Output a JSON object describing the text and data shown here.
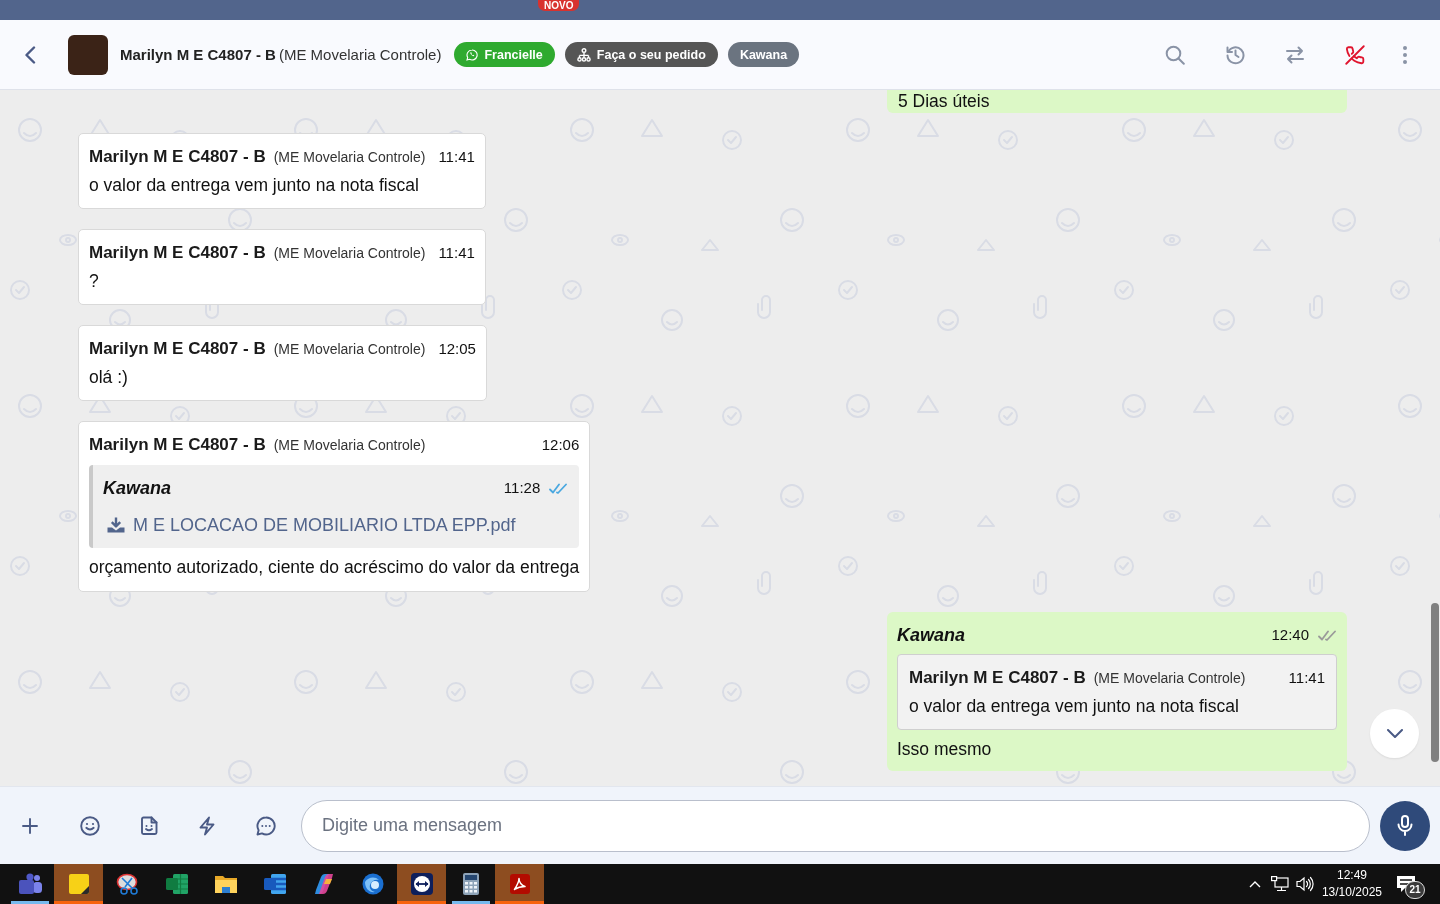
{
  "top_strip": {
    "badge": "NOVO"
  },
  "header": {
    "title": "Marilyn M E C4807 - B",
    "subtitle": "(ME Movelaria Controle)",
    "tags": [
      {
        "kind": "chat",
        "label": "Francielle",
        "color": "#2faa2f"
      },
      {
        "kind": "tree",
        "label": "Faça o seu pedido",
        "color": "#555555"
      },
      {
        "kind": "plain",
        "label": "Kawana",
        "color": "#6b7480"
      }
    ]
  },
  "messages": [
    {
      "kind": "outgoing",
      "text": "5 Dias úteis"
    },
    {
      "kind": "incoming",
      "sender": "Marilyn M E C4807 - B",
      "org": "(ME Movelaria Controle)",
      "time": "11:41",
      "text": "o valor da entrega vem junto na nota fiscal"
    },
    {
      "kind": "incoming",
      "sender": "Marilyn M E C4807 - B",
      "org": "(ME Movelaria Controle)",
      "time": "11:41",
      "text": "?"
    },
    {
      "kind": "incoming",
      "sender": "Marilyn M E C4807 - B",
      "org": "(ME Movelaria Controle)",
      "time": "12:05",
      "text": "olá :)"
    },
    {
      "kind": "incoming",
      "sender": "Marilyn M E C4807 - B",
      "org": "(ME Movelaria Controle)",
      "time": "12:06",
      "quote": {
        "kind": "outgoing",
        "sender": "Kawana",
        "time": "11:28",
        "read": true,
        "attachment": "M E LOCACAO DE MOBILIARIO LTDA EPP.pdf"
      },
      "text": "orçamento autorizado, ciente do acréscimo do valor da entrega"
    },
    {
      "kind": "outgoing",
      "sender": "Kawana",
      "time": "12:40",
      "read": false,
      "quote": {
        "kind": "incoming",
        "sender": "Marilyn M E C4807 - B",
        "org": "(ME Movelaria Controle)",
        "time": "11:41",
        "text": "o valor da entrega vem junto na nota fiscal"
      },
      "text": "Isso mesmo"
    }
  ],
  "composer": {
    "placeholder": "Digite uma mensagem"
  },
  "taskbar": {
    "apps": [
      {
        "open": true,
        "flashing": false
      },
      {
        "open": true,
        "flashing": true
      },
      {
        "open": false,
        "flashing": false
      },
      {
        "open": false,
        "flashing": false
      },
      {
        "open": false,
        "flashing": false
      },
      {
        "open": false,
        "flashing": false
      },
      {
        "open": false,
        "flashing": false
      },
      {
        "open": false,
        "flashing": false
      },
      {
        "open": true,
        "flashing": true
      },
      {
        "open": true,
        "flashing": false
      },
      {
        "open": true,
        "flashing": true
      }
    ],
    "clock": {
      "time": "12:49",
      "date": "13/10/2025"
    },
    "notification_count": "21"
  }
}
